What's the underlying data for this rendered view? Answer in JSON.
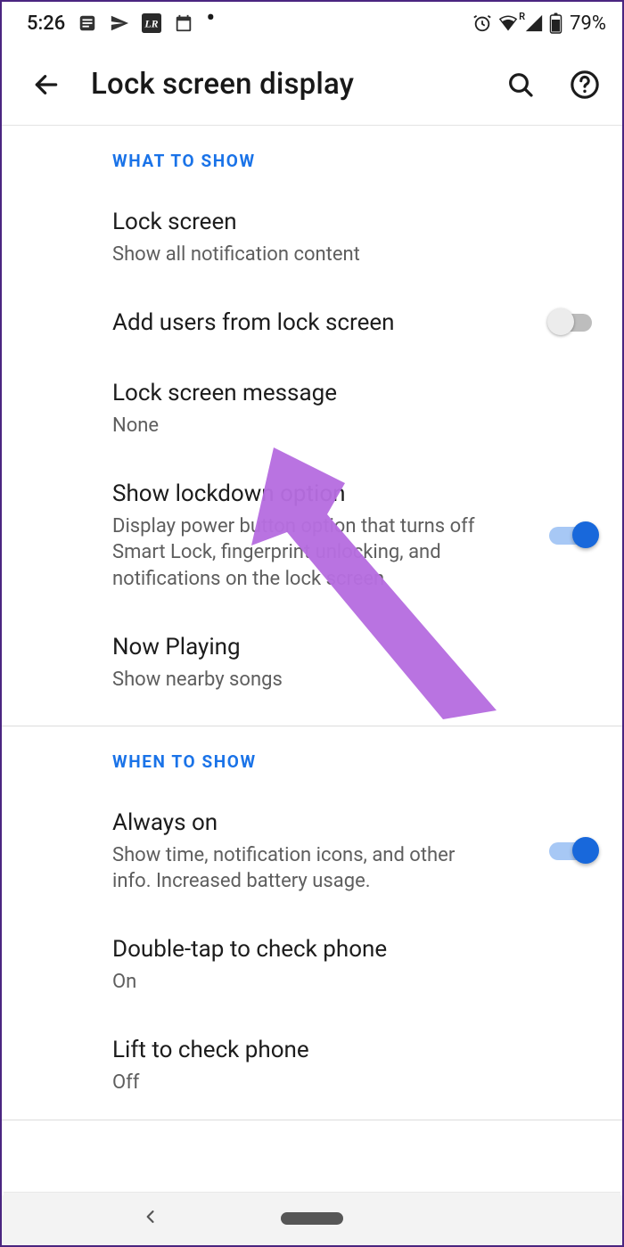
{
  "status": {
    "time": "5:26",
    "battery": "79%",
    "roaming_badge": "R"
  },
  "header": {
    "title": "Lock screen display"
  },
  "sections": [
    {
      "id": "what_to_show",
      "header": "WHAT TO SHOW",
      "items": [
        {
          "id": "lock_screen",
          "title": "Lock screen",
          "sub": "Show all notification content",
          "toggle": null
        },
        {
          "id": "add_users",
          "title": "Add users from lock screen",
          "sub": "",
          "toggle": false
        },
        {
          "id": "lock_msg",
          "title": "Lock screen message",
          "sub": "None",
          "toggle": null
        },
        {
          "id": "lockdown",
          "title": "Show lockdown option",
          "sub": "Display power button option that turns off Smart Lock, fingerprint unlocking, and notifications on the lock screen",
          "toggle": true
        },
        {
          "id": "now_playing",
          "title": "Now Playing",
          "sub": "Show nearby songs",
          "toggle": null
        }
      ]
    },
    {
      "id": "when_to_show",
      "header": "WHEN TO SHOW",
      "items": [
        {
          "id": "always_on",
          "title": "Always on",
          "sub": "Show time, notification icons, and other info. Increased battery usage.",
          "toggle": true
        },
        {
          "id": "double_tap",
          "title": "Double-tap to check phone",
          "sub": "On",
          "toggle": null
        },
        {
          "id": "lift",
          "title": "Lift to check phone",
          "sub": "Off",
          "toggle": null
        }
      ]
    }
  ],
  "annotation": {
    "target": "lock_msg",
    "color": "#b66de0"
  }
}
